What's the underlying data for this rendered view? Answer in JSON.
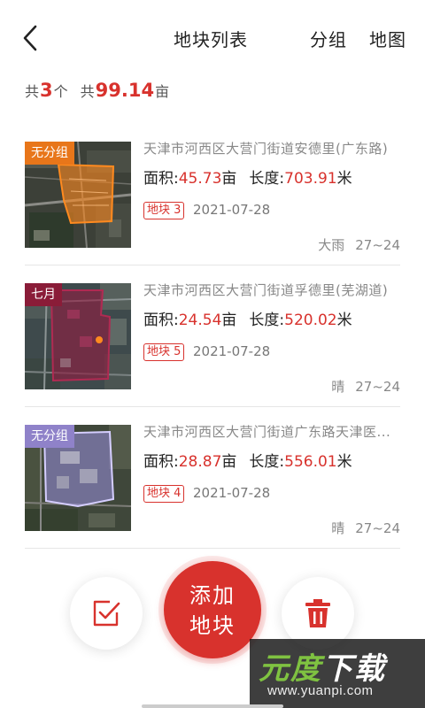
{
  "header": {
    "title": "地块列表",
    "group_label": "分组",
    "map_label": "地图"
  },
  "summary": {
    "count_prefix": "共",
    "count": "3",
    "count_unit": "个",
    "total_prefix": "共",
    "total_area": "99.14",
    "total_unit": "亩"
  },
  "list": {
    "items": [
      {
        "group_tag": "无分组",
        "tag_color": "#e8761a",
        "address": "天津市河西区大营门街道安德里(广东路)",
        "area_label": "面积:",
        "area_value": "45.73",
        "area_unit": "亩",
        "length_label": "长度:",
        "length_value": "703.91",
        "length_unit": "米",
        "plot_badge": "地块 3",
        "date": "2021-07-28",
        "weather": "大雨",
        "temperature": "27~24"
      },
      {
        "group_tag": "七月",
        "tag_color": "#8a1c38",
        "address": "天津市河西区大营门街道孚德里(芜湖道)",
        "area_label": "面积:",
        "area_value": "24.54",
        "area_unit": "亩",
        "length_label": "长度:",
        "length_value": "520.02",
        "length_unit": "米",
        "plot_badge": "地块 5",
        "date": "2021-07-28",
        "weather": "晴",
        "temperature": "27~24"
      },
      {
        "group_tag": "无分组",
        "tag_color": "#8f82c9",
        "address": "天津市河西区大营门街道广东路天津医...",
        "area_label": "面积:",
        "area_value": "28.87",
        "area_unit": "亩",
        "length_label": "长度:",
        "length_value": "556.01",
        "length_unit": "米",
        "plot_badge": "地块 4",
        "date": "2021-07-28",
        "weather": "晴",
        "temperature": "27~24"
      }
    ]
  },
  "actions": {
    "add_line1": "添加",
    "add_line2": "地块",
    "check_icon": "checkbox-icon",
    "trash_icon": "trash-icon"
  },
  "watermark": {
    "brand_green": "元",
    "brand_green2": "度",
    "brand_white": "下载",
    "brand_full": "元度下载",
    "url": "www.yuanpi.com"
  },
  "colors": {
    "accent": "#d8322d",
    "divider": "#e6e6e6"
  }
}
